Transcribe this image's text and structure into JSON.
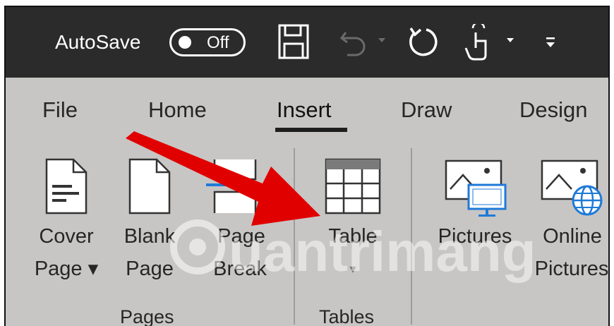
{
  "titlebar": {
    "autosave_label": "AutoSave",
    "autosave_state": "Off",
    "quick_access": [
      {
        "icon": "save-icon"
      },
      {
        "icon": "undo-icon"
      },
      {
        "icon": "redo-icon"
      },
      {
        "icon": "touch-mode-icon"
      },
      {
        "icon": "customize-toolbar-icon"
      }
    ]
  },
  "tabs": [
    "File",
    "Home",
    "Insert",
    "Draw",
    "Design"
  ],
  "active_tab": "Insert",
  "ribbon": {
    "pages_group": {
      "label": "Pages",
      "buttons": [
        {
          "line1": "Cover",
          "line2": "Page ▾",
          "icon": "cover-page-icon"
        },
        {
          "line1": "Blank",
          "line2": "Page",
          "icon": "blank-page-icon"
        },
        {
          "line1": "Page",
          "line2": "Break",
          "icon": "page-break-icon"
        }
      ]
    },
    "tables_group": {
      "label": "Tables",
      "buttons": [
        {
          "line1": "Table",
          "line2": "▾",
          "icon": "table-icon"
        }
      ]
    },
    "illustrations_group": {
      "buttons": [
        {
          "line1": "Pictures",
          "line2": "",
          "icon": "pictures-icon"
        },
        {
          "line1": "Online",
          "line2": "Pictures",
          "icon": "online-pictures-icon"
        }
      ]
    }
  },
  "watermark": "uantrimang",
  "colors": {
    "titlebar": "#2b2b2b",
    "ribbon": "#c8c6c4",
    "arrow": "#e00000",
    "monitor": "#1f7ad8"
  }
}
